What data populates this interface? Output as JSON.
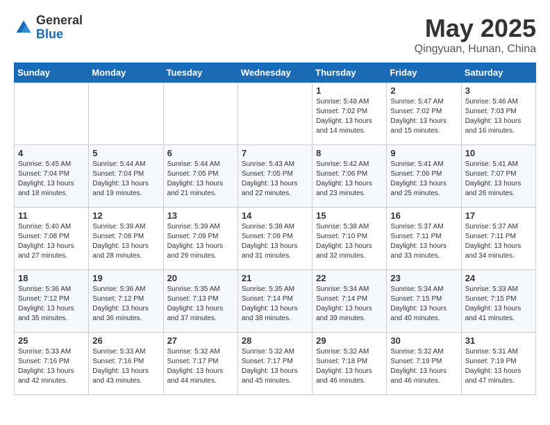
{
  "header": {
    "logo_general": "General",
    "logo_blue": "Blue",
    "title": "May 2025",
    "subtitle": "Qingyuan, Hunan, China"
  },
  "weekdays": [
    "Sunday",
    "Monday",
    "Tuesday",
    "Wednesday",
    "Thursday",
    "Friday",
    "Saturday"
  ],
  "weeks": [
    [
      {
        "day": "",
        "detail": ""
      },
      {
        "day": "",
        "detail": ""
      },
      {
        "day": "",
        "detail": ""
      },
      {
        "day": "",
        "detail": ""
      },
      {
        "day": "1",
        "detail": "Sunrise: 5:48 AM\nSunset: 7:02 PM\nDaylight: 13 hours\nand 14 minutes."
      },
      {
        "day": "2",
        "detail": "Sunrise: 5:47 AM\nSunset: 7:02 PM\nDaylight: 13 hours\nand 15 minutes."
      },
      {
        "day": "3",
        "detail": "Sunrise: 5:46 AM\nSunset: 7:03 PM\nDaylight: 13 hours\nand 16 minutes."
      }
    ],
    [
      {
        "day": "4",
        "detail": "Sunrise: 5:45 AM\nSunset: 7:04 PM\nDaylight: 13 hours\nand 18 minutes."
      },
      {
        "day": "5",
        "detail": "Sunrise: 5:44 AM\nSunset: 7:04 PM\nDaylight: 13 hours\nand 19 minutes."
      },
      {
        "day": "6",
        "detail": "Sunrise: 5:44 AM\nSunset: 7:05 PM\nDaylight: 13 hours\nand 21 minutes."
      },
      {
        "day": "7",
        "detail": "Sunrise: 5:43 AM\nSunset: 7:05 PM\nDaylight: 13 hours\nand 22 minutes."
      },
      {
        "day": "8",
        "detail": "Sunrise: 5:42 AM\nSunset: 7:06 PM\nDaylight: 13 hours\nand 23 minutes."
      },
      {
        "day": "9",
        "detail": "Sunrise: 5:41 AM\nSunset: 7:06 PM\nDaylight: 13 hours\nand 25 minutes."
      },
      {
        "day": "10",
        "detail": "Sunrise: 5:41 AM\nSunset: 7:07 PM\nDaylight: 13 hours\nand 26 minutes."
      }
    ],
    [
      {
        "day": "11",
        "detail": "Sunrise: 5:40 AM\nSunset: 7:08 PM\nDaylight: 13 hours\nand 27 minutes."
      },
      {
        "day": "12",
        "detail": "Sunrise: 5:39 AM\nSunset: 7:08 PM\nDaylight: 13 hours\nand 28 minutes."
      },
      {
        "day": "13",
        "detail": "Sunrise: 5:39 AM\nSunset: 7:09 PM\nDaylight: 13 hours\nand 29 minutes."
      },
      {
        "day": "14",
        "detail": "Sunrise: 5:38 AM\nSunset: 7:09 PM\nDaylight: 13 hours\nand 31 minutes."
      },
      {
        "day": "15",
        "detail": "Sunrise: 5:38 AM\nSunset: 7:10 PM\nDaylight: 13 hours\nand 32 minutes."
      },
      {
        "day": "16",
        "detail": "Sunrise: 5:37 AM\nSunset: 7:11 PM\nDaylight: 13 hours\nand 33 minutes."
      },
      {
        "day": "17",
        "detail": "Sunrise: 5:37 AM\nSunset: 7:11 PM\nDaylight: 13 hours\nand 34 minutes."
      }
    ],
    [
      {
        "day": "18",
        "detail": "Sunrise: 5:36 AM\nSunset: 7:12 PM\nDaylight: 13 hours\nand 35 minutes."
      },
      {
        "day": "19",
        "detail": "Sunrise: 5:36 AM\nSunset: 7:12 PM\nDaylight: 13 hours\nand 36 minutes."
      },
      {
        "day": "20",
        "detail": "Sunrise: 5:35 AM\nSunset: 7:13 PM\nDaylight: 13 hours\nand 37 minutes."
      },
      {
        "day": "21",
        "detail": "Sunrise: 5:35 AM\nSunset: 7:14 PM\nDaylight: 13 hours\nand 38 minutes."
      },
      {
        "day": "22",
        "detail": "Sunrise: 5:34 AM\nSunset: 7:14 PM\nDaylight: 13 hours\nand 39 minutes."
      },
      {
        "day": "23",
        "detail": "Sunrise: 5:34 AM\nSunset: 7:15 PM\nDaylight: 13 hours\nand 40 minutes."
      },
      {
        "day": "24",
        "detail": "Sunrise: 5:33 AM\nSunset: 7:15 PM\nDaylight: 13 hours\nand 41 minutes."
      }
    ],
    [
      {
        "day": "25",
        "detail": "Sunrise: 5:33 AM\nSunset: 7:16 PM\nDaylight: 13 hours\nand 42 minutes."
      },
      {
        "day": "26",
        "detail": "Sunrise: 5:33 AM\nSunset: 7:16 PM\nDaylight: 13 hours\nand 43 minutes."
      },
      {
        "day": "27",
        "detail": "Sunrise: 5:32 AM\nSunset: 7:17 PM\nDaylight: 13 hours\nand 44 minutes."
      },
      {
        "day": "28",
        "detail": "Sunrise: 5:32 AM\nSunset: 7:17 PM\nDaylight: 13 hours\nand 45 minutes."
      },
      {
        "day": "29",
        "detail": "Sunrise: 5:32 AM\nSunset: 7:18 PM\nDaylight: 13 hours\nand 46 minutes."
      },
      {
        "day": "30",
        "detail": "Sunrise: 5:32 AM\nSunset: 7:19 PM\nDaylight: 13 hours\nand 46 minutes."
      },
      {
        "day": "31",
        "detail": "Sunrise: 5:31 AM\nSunset: 7:19 PM\nDaylight: 13 hours\nand 47 minutes."
      }
    ]
  ]
}
